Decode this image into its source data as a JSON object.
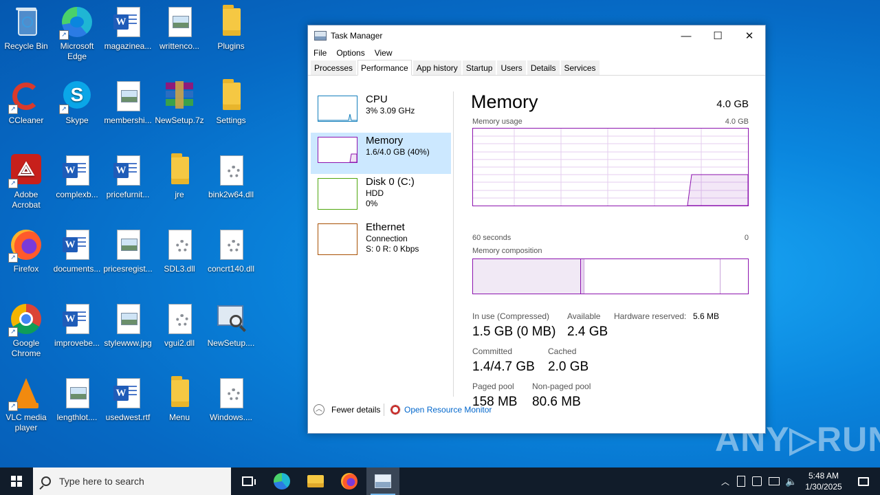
{
  "desktop": {
    "icons": [
      {
        "label": "Recycle Bin",
        "icon": "recycle-bin-icon"
      },
      {
        "label": "Microsoft Edge",
        "icon": "edge-icon"
      },
      {
        "label": "magazinea...",
        "icon": "word-document-icon"
      },
      {
        "label": "writtenco...",
        "icon": "image-file-icon"
      },
      {
        "label": "Plugins",
        "icon": "folder-icon"
      },
      {
        "label": "CCleaner",
        "icon": "ccleaner-icon"
      },
      {
        "label": "Skype",
        "icon": "skype-icon"
      },
      {
        "label": "membershi...",
        "icon": "image-file-icon"
      },
      {
        "label": "NewSetup.7z",
        "icon": "winrar-archive-icon"
      },
      {
        "label": "Settings",
        "icon": "folder-icon"
      },
      {
        "label": "Adobe Acrobat",
        "icon": "acrobat-icon"
      },
      {
        "label": "complexb...",
        "icon": "word-document-icon"
      },
      {
        "label": "pricefurnit...",
        "icon": "word-document-icon"
      },
      {
        "label": "jre",
        "icon": "folder-icon"
      },
      {
        "label": "bink2w64.dll",
        "icon": "dll-file-icon"
      },
      {
        "label": "Firefox",
        "icon": "firefox-icon"
      },
      {
        "label": "documents...",
        "icon": "word-document-icon"
      },
      {
        "label": "pricesregist...",
        "icon": "image-file-icon"
      },
      {
        "label": "SDL3.dll",
        "icon": "dll-file-icon"
      },
      {
        "label": "concrt140.dll",
        "icon": "dll-file-icon"
      },
      {
        "label": "Google Chrome",
        "icon": "chrome-icon"
      },
      {
        "label": "improvebe...",
        "icon": "word-document-icon"
      },
      {
        "label": "stylewww.jpg",
        "icon": "image-file-icon"
      },
      {
        "label": "vgui2.dll",
        "icon": "dll-file-icon"
      },
      {
        "label": "NewSetup....",
        "icon": "setup-magnifier-icon"
      },
      {
        "label": "VLC media player",
        "icon": "vlc-icon"
      },
      {
        "label": "lengthlot....",
        "icon": "image-file-icon"
      },
      {
        "label": "usedwest.rtf",
        "icon": "word-document-icon"
      },
      {
        "label": "Menu",
        "icon": "folder-icon"
      },
      {
        "label": "Windows....",
        "icon": "dll-file-icon"
      }
    ]
  },
  "taskmanager": {
    "title": "Task Manager",
    "window_controls": {
      "minimize": "—",
      "maximize": "☐",
      "close": "✕"
    },
    "menu": [
      "File",
      "Options",
      "View"
    ],
    "tabs": [
      "Processes",
      "Performance",
      "App history",
      "Startup",
      "Users",
      "Details",
      "Services"
    ],
    "active_tab": "Performance",
    "resources": [
      {
        "name": "CPU",
        "line1": "3% 3.09 GHz",
        "line2": "",
        "color": "#117dbb"
      },
      {
        "name": "Memory",
        "line1": "1.6/4.0 GB (40%)",
        "line2": "",
        "color": "#8b12ae"
      },
      {
        "name": "Disk 0 (C:)",
        "line1": "HDD",
        "line2": "0%",
        "color": "#4da60c"
      },
      {
        "name": "Ethernet",
        "line1": "Connection",
        "line2": "S: 0 R: 0 Kbps",
        "color": "#a74f01"
      }
    ],
    "memory": {
      "title": "Memory",
      "total": "4.0 GB",
      "usage_label": "Memory usage",
      "usage_max": "4.0 GB",
      "time_left": "60 seconds",
      "time_right": "0",
      "composition_label": "Memory composition",
      "in_use_label": "In use (Compressed)",
      "in_use_value": "1.5 GB (0 MB)",
      "available_label": "Available",
      "available_value": "2.4 GB",
      "hw_reserved_label": "Hardware reserved:",
      "hw_reserved_value": "5.6 MB",
      "committed_label": "Committed",
      "committed_value": "1.4/4.7 GB",
      "cached_label": "Cached",
      "cached_value": "2.0 GB",
      "paged_label": "Paged pool",
      "paged_value": "158 MB",
      "nonpaged_label": "Non-paged pool",
      "nonpaged_value": "80.6 MB"
    },
    "footer": {
      "fewer_details": "Fewer details",
      "resource_monitor": "Open Resource Monitor"
    }
  },
  "watermark": "ANY▷RUN",
  "taskbar": {
    "search_placeholder": "Type here to search",
    "time": "5:48 AM",
    "date": "1/30/2025"
  }
}
